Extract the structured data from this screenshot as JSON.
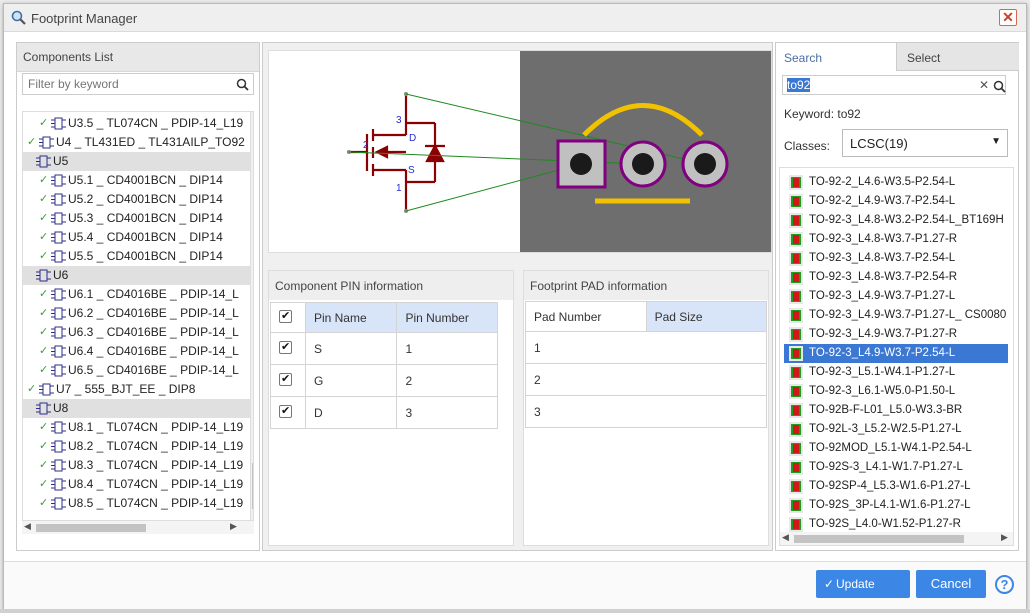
{
  "window": {
    "title": "Footprint Manager"
  },
  "left_panel": {
    "title": "Components List",
    "filter_placeholder": "Filter by keyword",
    "rows": [
      {
        "label": "U3.5 _ TL074CN _ PDIP-14_L19",
        "checked": true,
        "group": false,
        "indent": 1
      },
      {
        "label": "U4 _ TL431ED _ TL431AILP_TO92",
        "checked": true,
        "group": false,
        "indent": 0
      },
      {
        "label": "U5",
        "checked": false,
        "group": true,
        "indent": 0
      },
      {
        "label": "U5.1 _ CD4001BCN _ DIP14",
        "checked": true,
        "group": false,
        "indent": 1
      },
      {
        "label": "U5.2 _ CD4001BCN _ DIP14",
        "checked": true,
        "group": false,
        "indent": 1
      },
      {
        "label": "U5.3 _ CD4001BCN _ DIP14",
        "checked": true,
        "group": false,
        "indent": 1
      },
      {
        "label": "U5.4 _ CD4001BCN _ DIP14",
        "checked": true,
        "group": false,
        "indent": 1
      },
      {
        "label": "U5.5 _ CD4001BCN _ DIP14",
        "checked": true,
        "group": false,
        "indent": 1
      },
      {
        "label": "U6",
        "checked": false,
        "group": true,
        "indent": 0
      },
      {
        "label": "U6.1 _ CD4016BE _ PDIP-14_L",
        "checked": true,
        "group": false,
        "indent": 1
      },
      {
        "label": "U6.2 _ CD4016BE _ PDIP-14_L",
        "checked": true,
        "group": false,
        "indent": 1
      },
      {
        "label": "U6.3 _ CD4016BE _ PDIP-14_L",
        "checked": true,
        "group": false,
        "indent": 1
      },
      {
        "label": "U6.4 _ CD4016BE _ PDIP-14_L",
        "checked": true,
        "group": false,
        "indent": 1
      },
      {
        "label": "U6.5 _ CD4016BE _ PDIP-14_L",
        "checked": true,
        "group": false,
        "indent": 1
      },
      {
        "label": "U7 _ 555_BJT_EE _ DIP8",
        "checked": true,
        "group": false,
        "indent": 0
      },
      {
        "label": "U8",
        "checked": false,
        "group": true,
        "indent": 0
      },
      {
        "label": "U8.1 _ TL074CN _ PDIP-14_L19",
        "checked": true,
        "group": false,
        "indent": 1
      },
      {
        "label": "U8.2 _ TL074CN _ PDIP-14_L19",
        "checked": true,
        "group": false,
        "indent": 1
      },
      {
        "label": "U8.3 _ TL074CN _ PDIP-14_L19",
        "checked": true,
        "group": false,
        "indent": 1
      },
      {
        "label": "U8.4 _ TL074CN _ PDIP-14_L19",
        "checked": true,
        "group": false,
        "indent": 1
      },
      {
        "label": "U8.5 _ TL074CN _ PDIP-14_L19",
        "checked": true,
        "group": false,
        "indent": 1
      }
    ]
  },
  "preview": {
    "pin_labels": [
      "3",
      "2",
      "D",
      "S",
      "1"
    ]
  },
  "pin_info": {
    "title": "Component PIN information",
    "headers": [
      "Pin Name",
      "Pin Number"
    ],
    "rows": [
      {
        "name": "S",
        "number": "1",
        "checked": true
      },
      {
        "name": "G",
        "number": "2",
        "checked": true
      },
      {
        "name": "D",
        "number": "3",
        "checked": true
      }
    ]
  },
  "pad_info": {
    "title": "Footprint PAD information",
    "headers": [
      "Pad Number",
      "Pad Size"
    ],
    "rows": [
      "1",
      "2",
      "3"
    ]
  },
  "right_panel": {
    "tabs": [
      "Search",
      "Select"
    ],
    "search_value": "to92",
    "keyword_text": "Keyword: to92",
    "classes_label": "Classes:",
    "classes_value": "LCSC(19)",
    "footprints": [
      "TO-92-2_L4.6-W3.5-P2.54-L",
      "TO-92-2_L4.9-W3.7-P2.54-L",
      "TO-92-3_L4.8-W3.2-P2.54-L_BT169H",
      "TO-92-3_L4.8-W3.7-P1.27-R",
      "TO-92-3_L4.8-W3.7-P2.54-L",
      "TO-92-3_L4.8-W3.7-P2.54-R",
      "TO-92-3_L4.9-W3.7-P1.27-L",
      "TO-92-3_L4.9-W3.7-P1.27-L_ CS0080",
      "TO-92-3_L4.9-W3.7-P1.27-R",
      "TO-92-3_L4.9-W3.7-P2.54-L",
      "TO-92-3_L5.1-W4.1-P1.27-L",
      "TO-92-3_L6.1-W5.0-P1.50-L",
      "TO-92B-F-L01_L5.0-W3.3-BR",
      "TO-92L-3_L5.2-W2.5-P1.27-L",
      "TO-92MOD_L5.1-W4.1-P2.54-L",
      "TO-92S-3_L4.1-W1.7-P1.27-L",
      "TO-92SP-4_L5.3-W1.6-P1.27-L",
      "TO-92S_3P-L4.1-W1.6-P1.27-L",
      "TO-92S_L4.0-W1.52-P1.27-R"
    ],
    "selected_index": 9
  },
  "footer": {
    "update_label": "Update",
    "cancel_label": "Cancel",
    "help_label": "?"
  },
  "colors": {
    "accent": "#3c87e6",
    "selection": "#3b78d4",
    "schematic": "#8b0000",
    "pad_outline": "#800080",
    "silk": "#f2c200",
    "pcb_bg": "#6e6e6e"
  }
}
